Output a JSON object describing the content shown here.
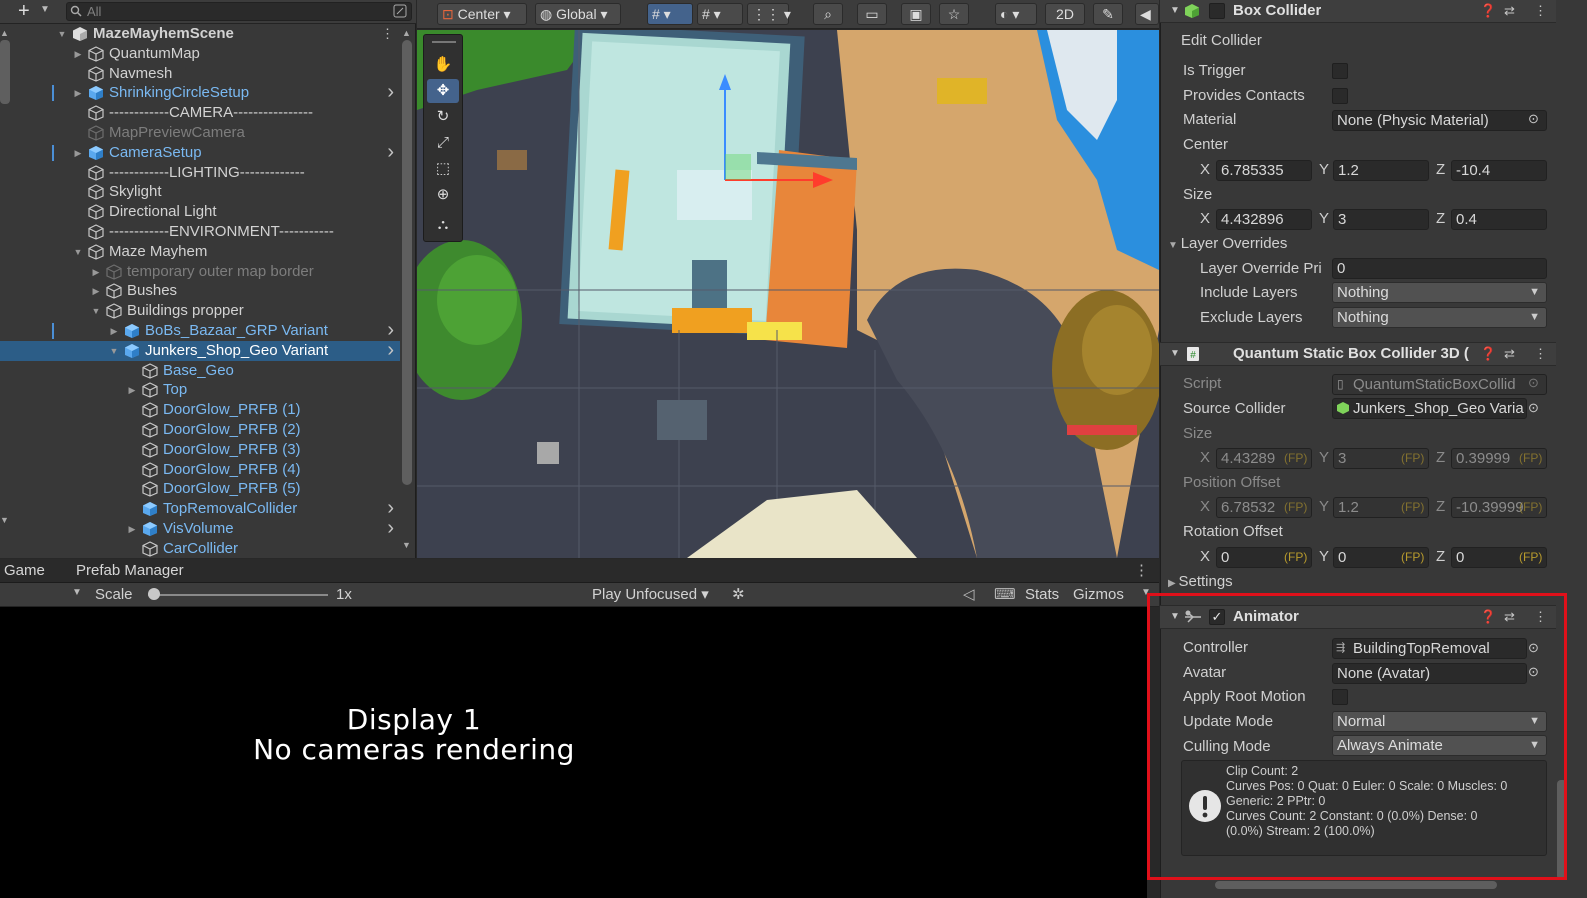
{
  "hierarchy": {
    "add_label": "+",
    "search_placeholder": "All",
    "rows": [
      {
        "label": "MazeMayhemScene",
        "indent": 0,
        "kind": "scene",
        "expanded": true,
        "menu": true
      },
      {
        "label": "QuantumMap",
        "indent": 1,
        "kind": "object",
        "collapsed": true
      },
      {
        "label": "Navmesh",
        "indent": 1,
        "kind": "object"
      },
      {
        "label": "ShrinkingCircleSetup",
        "indent": 1,
        "kind": "prefab",
        "collapsed": true,
        "more": true,
        "bar": true
      },
      {
        "label": "------------CAMERA----------------",
        "indent": 1,
        "kind": "object"
      },
      {
        "label": "MapPreviewCamera",
        "indent": 1,
        "kind": "dim"
      },
      {
        "label": "CameraSetup",
        "indent": 1,
        "kind": "prefab",
        "collapsed": true,
        "more": true,
        "bar": true
      },
      {
        "label": "------------LIGHTING-------------",
        "indent": 1,
        "kind": "object"
      },
      {
        "label": "Skylight",
        "indent": 1,
        "kind": "object"
      },
      {
        "label": "Directional Light",
        "indent": 1,
        "kind": "object"
      },
      {
        "label": "------------ENVIRONMENT-----------",
        "indent": 1,
        "kind": "object"
      },
      {
        "label": "Maze Mayhem",
        "indent": 1,
        "kind": "object",
        "expanded": true
      },
      {
        "label": "temporary outer map border",
        "indent": 2,
        "kind": "dim",
        "collapsed": true
      },
      {
        "label": "Bushes",
        "indent": 2,
        "kind": "object",
        "collapsed": true
      },
      {
        "label": "Buildings propper",
        "indent": 2,
        "kind": "object",
        "expanded": true
      },
      {
        "label": "BoBs_Bazaar_GRP Variant",
        "indent": 3,
        "kind": "prefab",
        "collapsed": true,
        "more": true,
        "bar": true
      },
      {
        "label": "Junkers_Shop_Geo Variant",
        "indent": 3,
        "kind": "prefab-sel",
        "expanded": true,
        "more": true,
        "selected": true
      },
      {
        "label": "Base_Geo",
        "indent": 4,
        "kind": "prefab-child"
      },
      {
        "label": "Top",
        "indent": 4,
        "kind": "prefab-child",
        "collapsed": true
      },
      {
        "label": "DoorGlow_PRFB (1)",
        "indent": 4,
        "kind": "prefab-child"
      },
      {
        "label": "DoorGlow_PRFB (2)",
        "indent": 4,
        "kind": "prefab-child"
      },
      {
        "label": "DoorGlow_PRFB (3)",
        "indent": 4,
        "kind": "prefab-child"
      },
      {
        "label": "DoorGlow_PRFB (4)",
        "indent": 4,
        "kind": "prefab-child"
      },
      {
        "label": "DoorGlow_PRFB (5)",
        "indent": 4,
        "kind": "prefab-child"
      },
      {
        "label": "TopRemovalCollider",
        "indent": 4,
        "kind": "prefab",
        "more": true
      },
      {
        "label": "VisVolume",
        "indent": 4,
        "kind": "prefab",
        "collapsed": true,
        "more": true
      },
      {
        "label": "CarCollider",
        "indent": 4,
        "kind": "prefab-child"
      }
    ]
  },
  "scene_toolbar": {
    "pivot": "Center",
    "space": "Global",
    "mode_2d": "2D"
  },
  "game": {
    "tabs": [
      "Game",
      "Prefab Manager"
    ],
    "scale_label": "Scale",
    "scale_value": "1x",
    "scale_fraction": 0.0,
    "play_mode": "Play Unfocused",
    "stats": "Stats",
    "gizmos": "Gizmos",
    "display_line1": "Display 1",
    "display_line2": "No cameras rendering"
  },
  "box_collider": {
    "title": "Box Collider",
    "edit_collider": "Edit Collider",
    "is_trigger_label": "Is Trigger",
    "provides_contacts_label": "Provides Contacts",
    "material_label": "Material",
    "material_value": "None (Physic Material)",
    "center_label": "Center",
    "center": {
      "x": "6.785335",
      "y": "1.2",
      "z": "-10.4"
    },
    "size_label": "Size",
    "size": {
      "x": "4.432896",
      "y": "3",
      "z": "0.4"
    },
    "layer_overrides_label": "Layer Overrides",
    "layer_priority_label": "Layer Override Pri",
    "layer_priority_value": "0",
    "include_layers_label": "Include Layers",
    "include_layers_value": "Nothing",
    "exclude_layers_label": "Exclude Layers",
    "exclude_layers_value": "Nothing"
  },
  "quantum": {
    "title": "Quantum Static Box Collider 3D (",
    "script_label": "Script",
    "script_value": "QuantumStaticBoxCollid",
    "source_label": "Source Collider",
    "source_value": "Junkers_Shop_Geo Varia",
    "size_label": "Size",
    "size": {
      "x": "4.43289",
      "y": "3",
      "z": "0.39999"
    },
    "pos_label": "Position Offset",
    "pos": {
      "x": "6.78532",
      "y": "1.2",
      "z": "-10.39999"
    },
    "rot_label": "Rotation Offset",
    "rot": {
      "x": "0",
      "y": "0",
      "z": "0"
    },
    "fp": "(FP)",
    "settings_label": "Settings"
  },
  "animator": {
    "title": "Animator",
    "controller_label": "Controller",
    "controller_value": "BuildingTopRemoval",
    "avatar_label": "Avatar",
    "avatar_value": "None (Avatar)",
    "root_motion_label": "Apply Root Motion",
    "update_mode_label": "Update Mode",
    "update_mode_value": "Normal",
    "culling_mode_label": "Culling Mode",
    "culling_mode_value": "Always Animate",
    "info": [
      "Clip Count: 2",
      "Curves Pos: 0 Quat: 0 Euler: 0 Scale: 0 Muscles: 0",
      "Generic: 2 PPtr: 0",
      "Curves Count: 2 Constant: 0 (0.0%) Dense: 0",
      "(0.0%) Stream: 2 (100.0%)"
    ]
  },
  "colors": {
    "highlight": "#e0101a",
    "prefab_blue": "#7ab9f2",
    "selection": "#2c5d87",
    "fp_text": "#b89b2d"
  }
}
